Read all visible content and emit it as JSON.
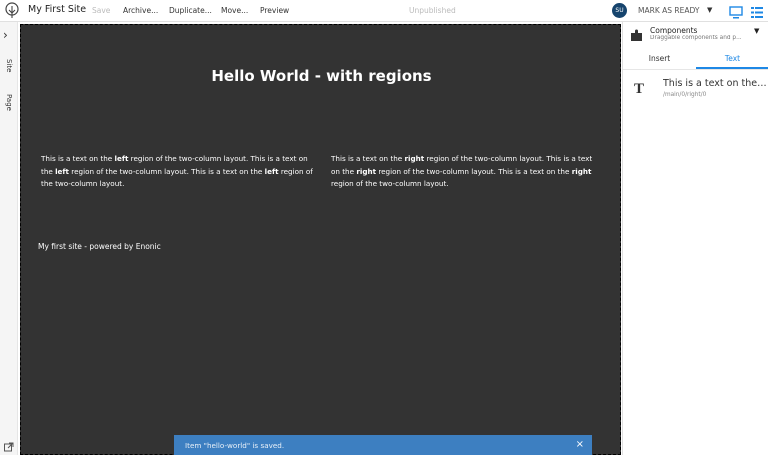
{
  "topbar": {
    "site_title": "My First Site",
    "save_label": "Save",
    "archive_label": "Archive...",
    "duplicate_label": "Duplicate...",
    "move_label": "Move...",
    "preview_label": "Preview",
    "status": "Unpublished",
    "avatar_initials": "SU",
    "mark_ready_label": "MARK AS READY"
  },
  "left_tabs": {
    "site_label": "Site",
    "page_label": "Page"
  },
  "page": {
    "title": "Hello World - with regions",
    "left_region": {
      "p1": "This is a text on the ",
      "b1": "left",
      "p2": " region of the two-column layout. This is a text on the ",
      "b2": "left",
      "p3": " region of the two-column layout. This is a text on the ",
      "b3": "left",
      "p4": " region of the two-column layout."
    },
    "right_region": {
      "p1": "This is a text on the ",
      "b1": "right",
      "p2": " region of the two-column layout. This is a text on the ",
      "b2": "right",
      "p3": " region of the two-column layout. This is a text on the ",
      "b3": "right",
      "p4": " region of the two-column layout."
    },
    "footer": "My first site - powered by Enonic"
  },
  "toast": {
    "message": "Item \"hello-world\" is saved.",
    "close": "×"
  },
  "panel": {
    "title": "Components",
    "subtitle": "Draggable components and p...",
    "tab_insert": "Insert",
    "tab_text": "Text",
    "item_title": "This is a text on the ri...",
    "item_path": "/main/0/right/0",
    "item_icon": "T"
  },
  "colors": {
    "canvas_bg": "#333333",
    "accent": "#1e88e5",
    "toast_bg": "#3d7fc1",
    "avatar_bg": "#16446d"
  },
  "icons": [
    "enonic-logo-icon",
    "chevron-right-icon",
    "external-link-icon",
    "puzzle-icon",
    "monitor-icon",
    "list-icon",
    "caret-down-icon",
    "text-icon",
    "close-icon"
  ]
}
